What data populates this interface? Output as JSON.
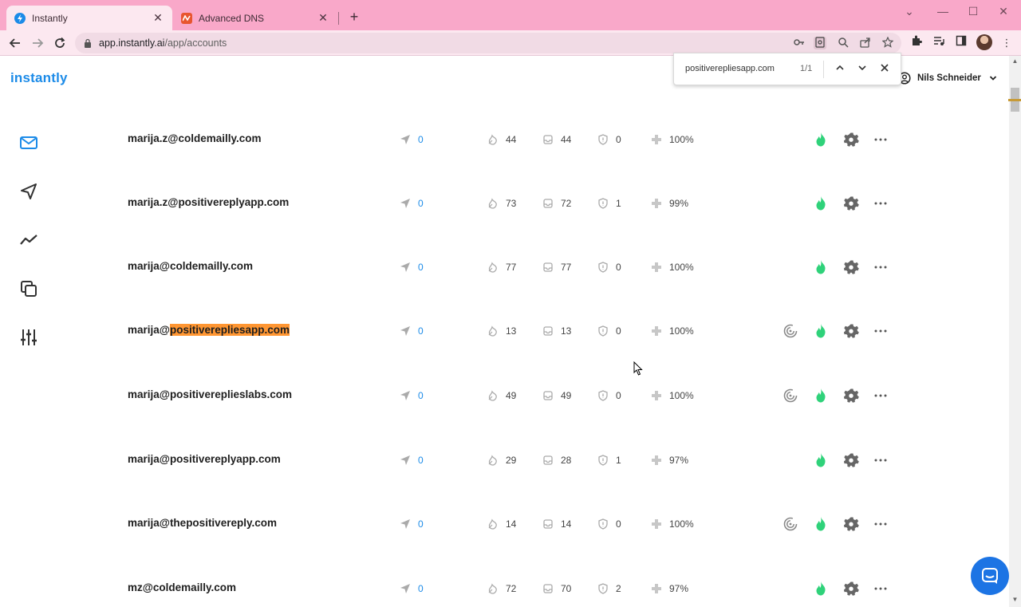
{
  "browser": {
    "tabs": [
      {
        "title": "Instantly",
        "active": true
      },
      {
        "title": "Advanced DNS",
        "active": false
      }
    ],
    "url_host": "app.instantly.ai",
    "url_path": "/app/accounts"
  },
  "app": {
    "logo": "instantly",
    "user_name": "Nils Schneider",
    "nav_items": [
      "mail-icon",
      "send-icon",
      "analytics-icon",
      "copy-icon",
      "settings-sliders-icon"
    ]
  },
  "find": {
    "query": "positiverepliesapp.com",
    "count": "1/1"
  },
  "accounts": [
    {
      "email_prefix": "marija.z@coldemailly.com",
      "email_highlight": "",
      "sent": "0",
      "replies": "44",
      "inbox": "44",
      "spam": "0",
      "health": "100%",
      "warmup_icon": false
    },
    {
      "email_prefix": "marija.z@positivereplyapp.com",
      "email_highlight": "",
      "sent": "0",
      "replies": "73",
      "inbox": "72",
      "spam": "1",
      "health": "99%",
      "warmup_icon": false
    },
    {
      "email_prefix": "marija@coldemailly.com",
      "email_highlight": "",
      "sent": "0",
      "replies": "77",
      "inbox": "77",
      "spam": "0",
      "health": "100%",
      "warmup_icon": false
    },
    {
      "email_prefix": "marija@",
      "email_highlight": "positiverepliesapp.com",
      "sent": "0",
      "replies": "13",
      "inbox": "13",
      "spam": "0",
      "health": "100%",
      "warmup_icon": true
    },
    {
      "email_prefix": "marija@positivereplieslabs.com",
      "email_highlight": "",
      "sent": "0",
      "replies": "49",
      "inbox": "49",
      "spam": "0",
      "health": "100%",
      "warmup_icon": true
    },
    {
      "email_prefix": "marija@positivereplyapp.com",
      "email_highlight": "",
      "sent": "0",
      "replies": "29",
      "inbox": "28",
      "spam": "1",
      "health": "97%",
      "warmup_icon": false
    },
    {
      "email_prefix": "marija@thepositivereply.com",
      "email_highlight": "",
      "sent": "0",
      "replies": "14",
      "inbox": "14",
      "spam": "0",
      "health": "100%",
      "warmup_icon": true
    },
    {
      "email_prefix": "mz@coldemailly.com",
      "email_highlight": "",
      "sent": "0",
      "replies": "72",
      "inbox": "70",
      "spam": "2",
      "health": "97%",
      "warmup_icon": false
    }
  ],
  "colors": {
    "brand": "#1c8be8",
    "tabbar": "#f9a8c9",
    "flame": "#2fd27a",
    "find_highlight": "#ff9632"
  }
}
